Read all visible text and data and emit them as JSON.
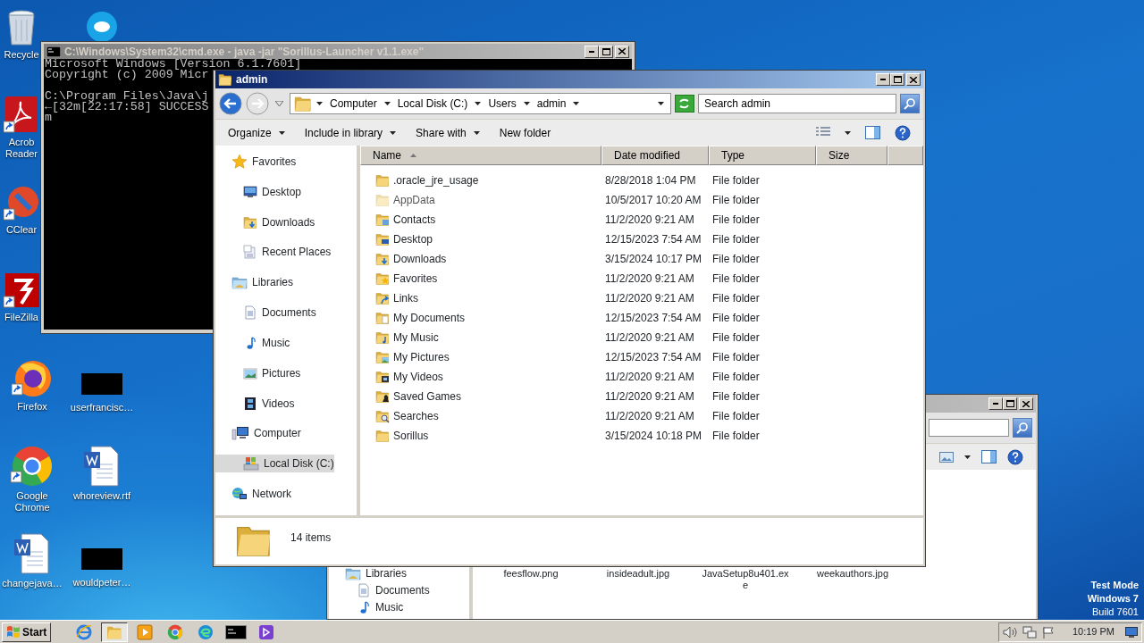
{
  "desktop": {
    "columns": [
      [
        {
          "label": "Recycle",
          "kind": "recycle",
          "shortcut": false
        },
        {
          "label": "Acrob Reader",
          "kind": "acrobat",
          "shortcut": true
        },
        {
          "label": "CClear",
          "kind": "ccleaner",
          "shortcut": true
        },
        {
          "label": "FileZilla",
          "kind": "filezilla",
          "shortcut": true
        },
        {
          "label": "Firefox",
          "kind": "firefox",
          "shortcut": true
        },
        {
          "label": "Google Chrome",
          "kind": "chrome",
          "shortcut": true
        },
        {
          "label": "changejava…",
          "kind": "word",
          "shortcut": false
        }
      ],
      [
        {
          "kind": "skype",
          "shortcut": false
        },
        {
          "label": "userfrancisc…",
          "kind": "redacted",
          "shortcut": false
        },
        {
          "label": "whoreview.rtf",
          "kind": "word",
          "shortcut": false
        },
        {
          "label": "wouldpeter…",
          "kind": "redacted",
          "shortcut": false
        }
      ]
    ]
  },
  "cmd_window": {
    "title": "C:\\Windows\\System32\\cmd.exe - java  -jar \"Sorillus-Launcher v1.1.exe\"",
    "active": false,
    "blocks": [
      [
        "Microsoft Windows [Version 6.1.7601]",
        "Copyright (c) 2009 Micr"
      ],
      [
        "C:\\Program Files\\Java\\j",
        "←[32m[22:17:58] SUCCESS",
        "m"
      ]
    ]
  },
  "explorer": {
    "title": "admin",
    "active": true,
    "back_enabled": true,
    "forward_enabled": false,
    "address": [
      "Computer",
      "Local Disk (C:)",
      "Users",
      "admin"
    ],
    "search": {
      "placeholder": "Search admin"
    },
    "toolbar": [
      {
        "label": "Organize",
        "dropdown": true
      },
      {
        "label": "Include in library",
        "dropdown": true
      },
      {
        "label": "Share with",
        "dropdown": true
      },
      {
        "label": "New folder",
        "dropdown": false
      }
    ],
    "nav": [
      {
        "label": "Favorites",
        "kind": "star",
        "selected": false,
        "children": [
          {
            "label": "Desktop",
            "kind": "monitor",
            "selected": false
          },
          {
            "label": "Downloads",
            "kind": "downloads",
            "selected": false
          },
          {
            "label": "Recent Places",
            "kind": "recent",
            "selected": false
          }
        ]
      },
      {
        "label": "Libraries",
        "kind": "libraries",
        "selected": false,
        "children": [
          {
            "label": "Documents",
            "kind": "document",
            "selected": false
          },
          {
            "label": "Music",
            "kind": "music",
            "selected": false
          },
          {
            "label": "Pictures",
            "kind": "picture",
            "selected": false
          },
          {
            "label": "Videos",
            "kind": "film",
            "selected": false
          }
        ]
      },
      {
        "label": "Computer",
        "kind": "computer",
        "selected": false,
        "children": [
          {
            "label": "Local Disk (C:)",
            "kind": "drive",
            "selected": true
          }
        ]
      },
      {
        "label": "Network",
        "kind": "network",
        "selected": false
      }
    ],
    "columns": [
      {
        "label": "Name",
        "sorted": true
      },
      {
        "label": "Date modified",
        "sorted": false
      },
      {
        "label": "Type",
        "sorted": false
      },
      {
        "label": "Size",
        "sorted": false
      }
    ],
    "rows": [
      {
        "name": ".oracle_jre_usage",
        "date": "8/28/2018 1:04 PM",
        "type": "File folder",
        "kind": "plain",
        "hidden": false
      },
      {
        "name": "AppData",
        "date": "10/5/2017 10:20 AM",
        "type": "File folder",
        "kind": "plain",
        "hidden": true
      },
      {
        "name": "Contacts",
        "date": "11/2/2020 9:21 AM",
        "type": "File folder",
        "kind": "contacts",
        "hidden": false
      },
      {
        "name": "Desktop",
        "date": "12/15/2023 7:54 AM",
        "type": "File folder",
        "kind": "desktop",
        "hidden": false
      },
      {
        "name": "Downloads",
        "date": "3/15/2024 10:17 PM",
        "type": "File folder",
        "kind": "downloads",
        "hidden": false
      },
      {
        "name": "Favorites",
        "date": "11/2/2020 9:21 AM",
        "type": "File folder",
        "kind": "favorites",
        "hidden": false
      },
      {
        "name": "Links",
        "date": "11/2/2020 9:21 AM",
        "type": "File folder",
        "kind": "links",
        "hidden": false
      },
      {
        "name": "My Documents",
        "date": "12/15/2023 7:54 AM",
        "type": "File folder",
        "kind": "documents",
        "hidden": false
      },
      {
        "name": "My Music",
        "date": "11/2/2020 9:21 AM",
        "type": "File folder",
        "kind": "music",
        "hidden": false
      },
      {
        "name": "My Pictures",
        "date": "12/15/2023 7:54 AM",
        "type": "File folder",
        "kind": "pictures",
        "hidden": false
      },
      {
        "name": "My Videos",
        "date": "11/2/2020 9:21 AM",
        "type": "File folder",
        "kind": "videos",
        "hidden": false
      },
      {
        "name": "Saved Games",
        "date": "11/2/2020 9:21 AM",
        "type": "File folder",
        "kind": "games",
        "hidden": false
      },
      {
        "name": "Searches",
        "date": "11/2/2020 9:21 AM",
        "type": "File folder",
        "kind": "searches",
        "hidden": false
      },
      {
        "name": "Sorillus",
        "date": "3/15/2024 10:18 PM",
        "type": "File folder",
        "kind": "plain",
        "hidden": false
      }
    ],
    "details": "14 items"
  },
  "background_window": {
    "active": false,
    "nav": [
      {
        "label": "Libraries",
        "kind": "libraries"
      },
      {
        "label": "Documents",
        "kind": "document"
      },
      {
        "label": "Music",
        "kind": "music"
      }
    ],
    "files": [
      "feesflow.png",
      "insideadult.jpg",
      "JavaSetup8u401.exe",
      "weekauthors.jpg"
    ]
  },
  "system_notice": [
    "Test Mode",
    "Windows 7",
    "Build 7601"
  ],
  "taskbar": {
    "start": "Start",
    "apps": [
      {
        "kind": "ie",
        "selected": false
      },
      {
        "kind": "explorer",
        "selected": true
      },
      {
        "kind": "media",
        "selected": false
      },
      {
        "kind": "chrome",
        "selected": false
      },
      {
        "kind": "edge",
        "selected": false
      },
      {
        "kind": "cmd",
        "selected": false
      },
      {
        "kind": "app",
        "selected": false
      }
    ],
    "clock": "10:19 PM"
  }
}
